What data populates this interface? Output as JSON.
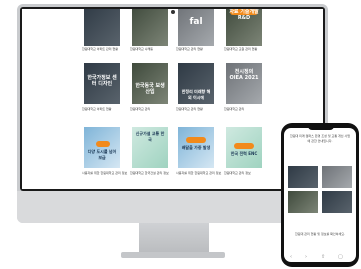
{
  "screen": {
    "top_row": [
      {
        "caption": "한림대학교 아파트 관리 현황"
      },
      {
        "caption": "한림대학교 나래동"
      },
      {
        "caption": "한림대학교 관리 현황",
        "tile": "fal"
      },
      {
        "caption": "한림대학교 교원 관리 현황",
        "tile": "자료 기술개발 R&D"
      }
    ],
    "middle_row": [
      {
        "caption": "한림대학교 아파트 현황",
        "tile": "한국가정보 센터 디자인"
      },
      {
        "caption": "한림대학교 관리",
        "tile": "한국동국 보생산입"
      },
      {
        "caption": "한림대학교 관리 현황",
        "tile": "한정리 미래향 해외 이시에"
      },
      {
        "caption": "한림대학교 관리",
        "tile": "전시정의 OIEA 2021"
      }
    ],
    "bottom_row": [
      {
        "caption": "사용자를 위한 한림대학교 관리 정보",
        "tile": "다양 도시를 넘어 보급"
      },
      {
        "caption": "한림대학교 한국건설 관리 정보",
        "tile": "신규가설 교통 한국"
      },
      {
        "caption": "사용자를 위한 한림대학교 관리 정보",
        "tile": "배달을 가중 발생"
      },
      {
        "caption": "한림대학교 관리 정보",
        "tile": "한국 전력 ENC"
      }
    ]
  },
  "phone": {
    "intro_text": "한림대 미래 캠퍼스 환경 조성 및 교통 개선 사업에 관한 안내입니다.",
    "outro_text": "한림대 관리 현황 및 정보를 확인하세요.",
    "nav": {
      "back": "‹",
      "forward": "›",
      "share": "⇧",
      "tabs": "▢"
    }
  },
  "colors": {
    "accent": "#f28a1b",
    "monitor_silver": "#c9cbce"
  }
}
